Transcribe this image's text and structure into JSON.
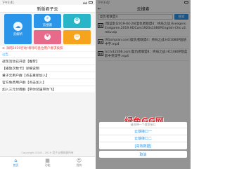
{
  "left": {
    "status": {
      "time": "下午3:41",
      "signal": "▲▲"
    },
    "title": "新版君子云",
    "tiles": [
      {
        "icon": "cloud-upload-icon",
        "glyph": "☁",
        "label": "云解析"
      },
      {
        "icon": "search-icon",
        "glyph": "⌕",
        "label": "云搜索"
      },
      {
        "icon": "gear-icon",
        "glyph": "⚙",
        "label": ""
      },
      {
        "icon": "heart-icon",
        "glyph": "♥",
        "label": ""
      },
      {
        "icon": "key-icon",
        "glyph": "⚿",
        "label": ""
      }
    ],
    "notice": "净网2019行动!将呼吁各位用户要求按照",
    "section_title": "公告",
    "items": [
      "返现活动已开启【推荐】",
      "【播放次数卡】详细说明",
      "君子云用户群【点击重新加入】",
      "官方免费用户群【点击加入】",
      "加入三元付费群【带你装逼带你飞】"
    ],
    "footer": "Copyright 2018 - 2019  君子云播放器所有",
    "tabs": [
      {
        "icon": "home-icon",
        "glyph": "⌂",
        "label": "首页"
      },
      {
        "icon": "grid-icon",
        "glyph": "▦",
        "label": "功能"
      },
      {
        "icon": "user-icon",
        "glyph": "☺",
        "label": "我的"
      }
    ]
  },
  "right": {
    "status": {
      "time": "下午3:42"
    },
    "title": "云搜索",
    "back_glyph": "←",
    "search_value": "复仇者联盟4",
    "search_button": "搜索",
    "results": [
      "[悠蓝影]2019-04-26[复仇者联盟4：终局之战.Avengers.Endgame.2019.HDCam1920x1080P.English-Chs.v2.mkv.zip",
      "[91xinpian.com]复仇者联盟4：终局之战.HD1080P国语中字.mp4",
      "[cctv12306.com]复仇者联盟4：终局之战.HC1080P悠蓝影中英双字.mp4"
    ],
    "sheet": {
      "header": "请选择一个搜索接口",
      "options": [
        "云端接口一",
        "云端接口二",
        "[高效数据]"
      ],
      "cancel": "取消"
    },
    "watermark": {
      "title": "绿色GG网",
      "url": "www.greengg.com"
    }
  }
}
